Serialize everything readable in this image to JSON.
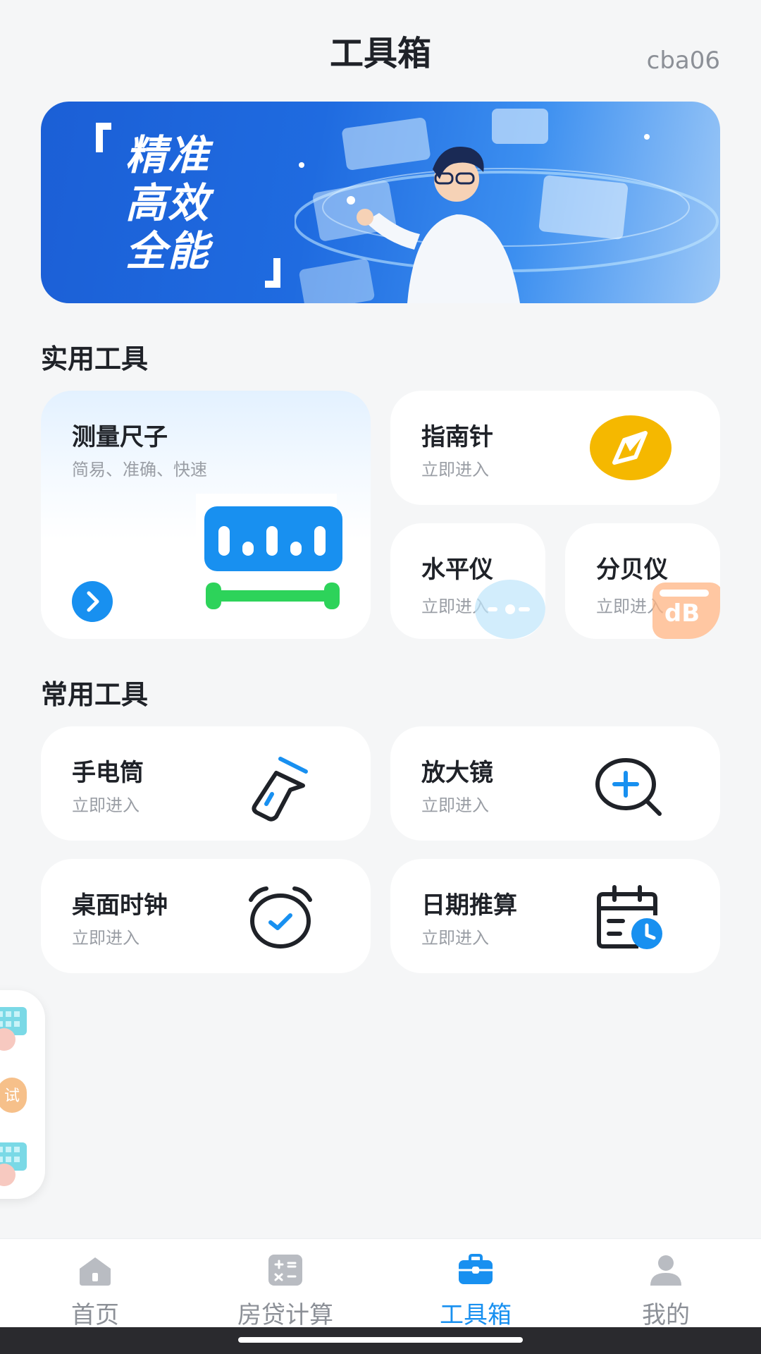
{
  "header": {
    "title": "工具箱",
    "user": "cba06"
  },
  "banner": {
    "slogan": [
      "精准",
      "高效",
      "全能"
    ]
  },
  "sections": {
    "practical": "实用工具",
    "common": "常用工具"
  },
  "practical_tools": {
    "ruler": {
      "name": "测量尺子",
      "desc": "简易、准确、快速"
    },
    "compass": {
      "name": "指南针",
      "desc": "立即进入"
    },
    "level": {
      "name": "水平仪",
      "desc": "立即进入"
    },
    "decibel": {
      "name": "分贝仪",
      "desc": "立即进入",
      "icon_text": "dB"
    }
  },
  "common_tools": {
    "flashlight": {
      "name": "手电筒",
      "desc": "立即进入"
    },
    "magnifier": {
      "name": "放大镜",
      "desc": "立即进入"
    },
    "clock": {
      "name": "桌面时钟",
      "desc": "立即进入"
    },
    "date_calc": {
      "name": "日期推算",
      "desc": "立即进入"
    }
  },
  "side_widget": {
    "badge_text": "试"
  },
  "tabbar": {
    "items": [
      {
        "label": "首页",
        "icon": "home-icon"
      },
      {
        "label": "房贷计算",
        "icon": "calculator-icon"
      },
      {
        "label": "工具箱",
        "icon": "toolbox-icon",
        "active": true
      },
      {
        "label": "我的",
        "icon": "user-icon"
      }
    ]
  },
  "colors": {
    "accent": "#1890f0",
    "compass": "#f5b800",
    "ruler_bar": "#1890f0",
    "ruler_base": "#2dd35a",
    "decibel": "#ff9a5a"
  }
}
